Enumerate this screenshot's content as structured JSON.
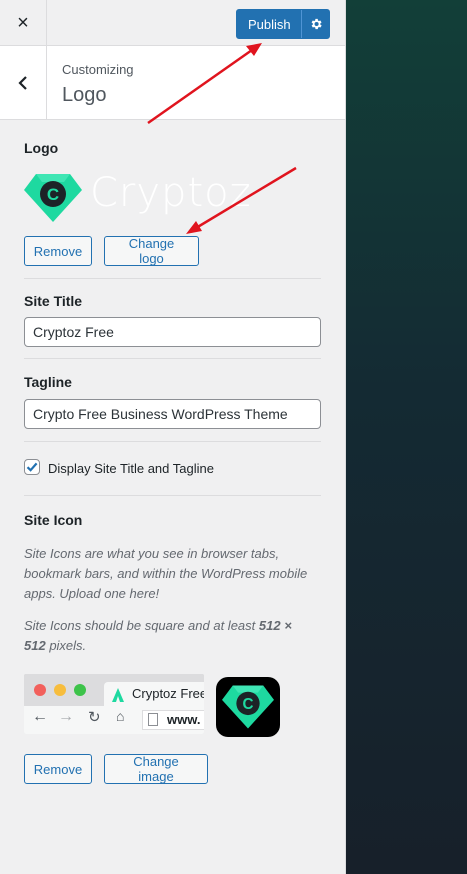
{
  "header": {
    "close_label": "×",
    "publish_label": "Publish",
    "breadcrumb": "Customizing",
    "section_title": "Logo"
  },
  "logo": {
    "label": "Logo",
    "brand_text": "Cryptoz",
    "brand_letter": "C",
    "remove_label": "Remove",
    "change_label": "Change logo"
  },
  "site_title": {
    "label": "Site Title",
    "value": "Cryptoz Free"
  },
  "tagline": {
    "label": "Tagline",
    "value": "Crypto Free Business WordPress Theme"
  },
  "display_toggle": {
    "label": "Display Site Title and Tagline",
    "checked": true
  },
  "site_icon": {
    "label": "Site Icon",
    "desc1": "Site Icons are what you see in browser tabs, bookmark bars, and within the WordPress mobile apps. Upload one here!",
    "desc2_before": "Site Icons should be square and at least ",
    "desc2_size": "512 × 512",
    "desc2_after": " pixels.",
    "tab_title": "Cryptoz Free",
    "url_text": "www.",
    "remove_label": "Remove",
    "change_label": "Change image"
  },
  "colors": {
    "accent": "#2271b1",
    "brand_green": "#1ed9a0",
    "annotation_red": "#e0141e"
  }
}
